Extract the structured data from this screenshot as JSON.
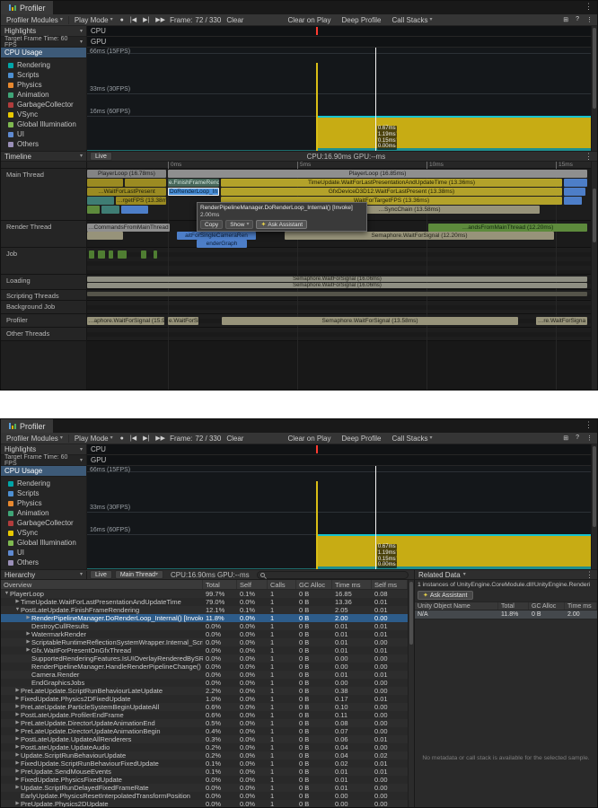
{
  "stats": "CPU:16.90ms   GPU:--ms",
  "icons": {
    "chevron": "▾",
    "kebab": "⋮",
    "record": "●",
    "step_back": "|◀",
    "step_fwd": "▶|",
    "step_last": "▶▶",
    "grid": "⊞",
    "help": "?",
    "sparkle": "✦"
  },
  "tab": {
    "title": "Profiler"
  },
  "toolbar": {
    "modules": "Profiler Modules",
    "play_mode": "Play Mode",
    "frame_label": "Frame:",
    "frame_value": "72 / 330",
    "clear": "Clear",
    "clear_on_play": "Clear on Play",
    "deep_profile": "Deep Profile",
    "call_stacks": "Call Stacks"
  },
  "highlights": {
    "title": "Highlights",
    "target": "Target Frame Time: 60 FPS",
    "cpu_label": "CPU",
    "gpu_label": "GPU"
  },
  "cpu_module": {
    "title": "CPU Usage",
    "legend": [
      {
        "label": "Rendering",
        "color": "#00a5a8",
        "sw": "background:#00a5a8"
      },
      {
        "label": "Scripts",
        "color": "#4d8fd1",
        "sw": "background:#4d8fd1"
      },
      {
        "label": "Physics",
        "color": "#e8882e",
        "sw": "background:#e8882e"
      },
      {
        "label": "Animation",
        "color": "#3fa577",
        "sw": "background:#3fa577"
      },
      {
        "label": "GarbageCollector",
        "color": "#b03c3c",
        "sw": "background:#b03c3c"
      },
      {
        "label": "VSync",
        "color": "#e8c800",
        "sw": "background:#e8c800"
      },
      {
        "label": "Global Illumination",
        "color": "#7fb950",
        "sw": "background:#7fb950"
      },
      {
        "label": "UI",
        "color": "#5f8ad1",
        "sw": "background:#5f8ad1"
      },
      {
        "label": "Others",
        "color": "#9a8fb8",
        "sw": "background:#9a8fb8"
      }
    ],
    "gridlines": [
      {
        "label": "66ms (15FPS)"
      },
      {
        "label": "33ms (30FPS)"
      },
      {
        "label": "16ms (60FPS)"
      }
    ],
    "frame_values": [
      {
        "label": "0.67ms",
        "style": "bottom:21px"
      },
      {
        "label": "1.19ms",
        "style": "bottom:14px"
      },
      {
        "label": "0.15ms",
        "style": "bottom:7px"
      },
      {
        "label": "0.00ms",
        "style": "bottom:1px"
      }
    ]
  },
  "timeline": {
    "title": "Timeline",
    "live": "Live",
    "ruler": [
      {
        "label": "0ms",
        "style": "left:90px"
      },
      {
        "label": "5ms",
        "style": "left:234px"
      },
      {
        "label": "10ms",
        "style": "left:378px"
      },
      {
        "label": "15ms",
        "style": "left:522px"
      }
    ],
    "threads": [
      {
        "label": "Main Thread",
        "style": "height:58px"
      },
      {
        "label": "Render Thread",
        "style": "height:30px"
      },
      {
        "label": "Job",
        "style": "height:30px"
      },
      {
        "label": "Loading",
        "style": "height:17px"
      },
      {
        "label": "Scripting Threads",
        "style": "height:12px"
      },
      {
        "label": "Background Job",
        "style": "height:15px"
      },
      {
        "label": "Profiler",
        "style": "height:15px"
      },
      {
        "label": "Other Threads",
        "style": "height:15px"
      }
    ],
    "bars": [
      {
        "style": "left:0px;top:1px;width:88px;background:#848484;color:#1b1b1b",
        "label": "PlayerLoop (16.78ms)"
      },
      {
        "style": "left:90px;top:1px;width:467px;background:#8f8f8f;color:#1b1b1b",
        "label": "PlayerLoop (16.85ms)"
      },
      {
        "style": "left:0px;top:11px;width:40px;background:#9b8b22;color:#20200a",
        "label": ""
      },
      {
        "style": "left:42px;top:11px;width:46px;background:#9b8b22;color:#20200a",
        "label": ""
      },
      {
        "style": "left:90px;top:11px;width:57px;background:#47675a;color:#d8e8e0",
        "label": "e.FinishFrameRende"
      },
      {
        "style": "left:149px;top:11px;width:380px;background:#b3a22a;color:#1e1c05",
        "label": "TimeUpdate.WaitForLastPresentationAndUpdateTime (13.36ms)"
      },
      {
        "style": "left:531px;top:11px;width:26px;background:#4d7ec8;color:#0b1d36",
        "label": ""
      },
      {
        "style": "left:0px;top:21px;width:88px;background:#9b8b22;color:#20200a",
        "label": "…WaitForLastPresent"
      },
      {
        "style": "left:90px;top:21px;width:57px;background:#4a90d9;color:#081c30;outline:1px solid #f0f0f0;outline-offset:-1px",
        "label": "DoRenderLoop_In"
      },
      {
        "style": "left:149px;top:21px;width:380px;background:#b3a22a;color:#1e1c05",
        "label": "GfxDeviceD3D12.WaitForLastPresent (13.38ms)"
      },
      {
        "style": "left:531px;top:21px;width:24px;background:#4d7ec8;color:#0b1d36",
        "label": ""
      },
      {
        "style": "left:0px;top:31px;width:30px;background:#3f7d74;color:#0c1f1c",
        "label": ""
      },
      {
        "style": "left:32px;top:31px;width:56px;background:#9b8b22;color:#20200a",
        "label": "…rgetFPS (13.38ms)"
      },
      {
        "style": "left:149px;top:31px;width:380px;background:#b3a22a;color:#1e1c05",
        "label": "WaitForTargetFPS (13.36ms)"
      },
      {
        "style": "left:531px;top:31px;width:20px;background:#4d7ec8;color:#0b1d36",
        "label": ""
      },
      {
        "style": "left:0px;top:41px;width:14px;background:#5d8a3c;color:#10270c",
        "label": ""
      },
      {
        "style": "left:16px;top:41px;width:20px;background:#3f7d74;color:#0c1f1c",
        "label": ""
      },
      {
        "style": "left:38px;top:41px;width:30px;background:#4d7ec8;color:#0b1d36",
        "label": ""
      },
      {
        "style": "left:214px;top:41px;width:290px;background:#97937a;color:#23231a",
        "label": "…SyncChain (13.58ms)"
      },
      {
        "style": "left:0px;top:61px;width:92px;background:#8f8f8f;color:#1b1b1b",
        "label": "…CommandsFromMainThread (13.88ms)"
      },
      {
        "style": "left:380px;top:61px;width:177px;background:#5d8a3c;color:#10270c",
        "label": "…andsFromMainThread (12.20ms)"
      },
      {
        "style": "left:0px;top:70px;width:40px;background:#97937a;color:#23231a",
        "label": ""
      },
      {
        "style": "left:100px;top:70px;width:88px;background:#4d7ec8;color:#0b1d36",
        "label": "aitForSingleCameraRen"
      },
      {
        "style": "left:220px;top:70px;width:300px;background:#97937a;color:#23231a",
        "label": "Semaphore.WaitForSignal (12.20ms)"
      },
      {
        "style": "left:122px;top:79px;width:56px;background:#4d7ec8;color:#0b1d36",
        "label": "enderGraph"
      },
      {
        "style": "left:2px;top:91px;width:6px;background:#4f7d32",
        "label": ""
      },
      {
        "style": "left:12px;top:91px;width:8px;background:#4f7d32",
        "label": ""
      },
      {
        "style": "left:24px;top:91px;width:5px;background:#4f7d32",
        "label": ""
      },
      {
        "style": "left:34px;top:91px;width:10px;background:#4f7d32",
        "label": ""
      },
      {
        "style": "left:60px;top:91px;width:6px;background:#4f7d32",
        "label": ""
      },
      {
        "style": "left:74px;top:91px;width:4px;background:#4f7d32",
        "label": ""
      },
      {
        "style": "left:0px;top:120px;width:557px;height:6px;line-height:6px;font-size:6px;background:#8e8e82;color:#23231a",
        "label": "Semaphore.WaitForSignal (16.06ms)"
      },
      {
        "style": "left:0px;top:127px;width:557px;height:6px;line-height:6px;font-size:6px;background:#8e8e82;color:#23231a",
        "label": "Semaphore.WaitForSignal (16.06ms)"
      },
      {
        "style": "left:0px;top:137px;width:557px;height:5px;background:#55544a",
        "label": ""
      },
      {
        "style": "left:0px;top:165px;width:86px;background:#97937a;color:#23231a",
        "label": "…aphore.WaitForSignal (15.92ms)"
      },
      {
        "style": "left:90px;top:165px;width:34px;background:#97937a;color:#23231a",
        "label": "e.WaitForSign"
      },
      {
        "style": "left:150px;top:165px;width:330px;background:#97937a;color:#23231a",
        "label": "Semaphore.WaitForSignal (13.58ms)"
      },
      {
        "style": "left:500px;top:165px;width:57px;background:#97937a;color:#23231a",
        "label": "…re.WaitForSigna"
      }
    ],
    "tooltip": {
      "title": "RenderPipelineManager.DoRenderLoop_Internal() [Invoke]",
      "time": "2.00ms",
      "copy": "Copy",
      "show": "Show",
      "ask": "Ask Assistant"
    }
  },
  "hierarchy": {
    "title": "Hierarchy",
    "live": "Live",
    "thread": "Main Thread",
    "search_value": "",
    "columns": [
      "Overview",
      "Total",
      "Self",
      "Calls",
      "GC Alloc",
      "Time ms",
      "Self ms"
    ],
    "rows": [
      {
        "name": "PlayerLoop",
        "arrow": "▼",
        "ind": "width:3px",
        "sel": "false",
        "total": "99.7%",
        "self": "0.1%",
        "calls": "1",
        "gc": "0 B",
        "time": "16.85",
        "selfms": "0.08"
      },
      {
        "name": "TimeUpdate.WaitForLastPresentationAndUpdateTime",
        "arrow": "▶",
        "ind": "width:15px",
        "sel": "false",
        "total": "79.0%",
        "self": "0.0%",
        "calls": "1",
        "gc": "0 B",
        "time": "13.36",
        "selfms": "0.01"
      },
      {
        "name": "PostLateUpdate.FinishFrameRendering",
        "arrow": "▼",
        "ind": "width:15px",
        "sel": "false",
        "total": "12.1%",
        "self": "0.1%",
        "calls": "1",
        "gc": "0 B",
        "time": "2.05",
        "selfms": "0.01"
      },
      {
        "name": "RenderPipelineManager.DoRenderLoop_Internal() [Invoke]",
        "arrow": "▶",
        "ind": "width:27px",
        "sel": "true",
        "total": "11.8%",
        "self": "0.0%",
        "calls": "1",
        "gc": "0 B",
        "time": "2.00",
        "selfms": "0.00"
      },
      {
        "name": "DestroyCullResults",
        "arrow": "",
        "ind": "width:27px",
        "sel": "false",
        "total": "0.0%",
        "self": "0.0%",
        "calls": "1",
        "gc": "0 B",
        "time": "0.01",
        "selfms": "0.01"
      },
      {
        "name": "WatermarkRender",
        "arrow": "▶",
        "ind": "width:27px",
        "sel": "false",
        "total": "0.0%",
        "self": "0.0%",
        "calls": "1",
        "gc": "0 B",
        "time": "0.01",
        "selfms": "0.01"
      },
      {
        "name": "ScriptableRuntimeReflectionSystemWrapper.Internal_Scrip",
        "arrow": "▶",
        "ind": "width:27px",
        "sel": "false",
        "total": "0.0%",
        "self": "0.0%",
        "calls": "1",
        "gc": "0 B",
        "time": "0.01",
        "selfms": "0.00"
      },
      {
        "name": "Gfx.WaitForPresentOnGfxThread",
        "arrow": "▶",
        "ind": "width:27px",
        "sel": "false",
        "total": "0.0%",
        "self": "0.0%",
        "calls": "1",
        "gc": "0 B",
        "time": "0.01",
        "selfms": "0.01"
      },
      {
        "name": "SupportedRenderingFeatures.IsUIOverlayRenderedBySRP()",
        "arrow": "",
        "ind": "width:27px",
        "sel": "false",
        "total": "0.0%",
        "self": "0.0%",
        "calls": "1",
        "gc": "0 B",
        "time": "0.00",
        "selfms": "0.00"
      },
      {
        "name": "RenderPipelineManager.HandleRenderPipelineChange() [Inv",
        "arrow": "",
        "ind": "width:27px",
        "sel": "false",
        "total": "0.0%",
        "self": "0.0%",
        "calls": "1",
        "gc": "0 B",
        "time": "0.00",
        "selfms": "0.00"
      },
      {
        "name": "Camera.Render",
        "arrow": "",
        "ind": "width:27px",
        "sel": "false",
        "total": "0.0%",
        "self": "0.0%",
        "calls": "1",
        "gc": "0 B",
        "time": "0.01",
        "selfms": "0.01"
      },
      {
        "name": "EndGraphicsJobs",
        "arrow": "",
        "ind": "width:27px",
        "sel": "false",
        "total": "0.0%",
        "self": "0.0%",
        "calls": "1",
        "gc": "0 B",
        "time": "0.00",
        "selfms": "0.00"
      },
      {
        "name": "PreLateUpdate.ScriptRunBehaviourLateUpdate",
        "arrow": "▶",
        "ind": "width:15px",
        "sel": "false",
        "total": "2.2%",
        "self": "0.0%",
        "calls": "1",
        "gc": "0 B",
        "time": "0.38",
        "selfms": "0.00"
      },
      {
        "name": "FixedUpdate.Physics2DFixedUpdate",
        "arrow": "▶",
        "ind": "width:15px",
        "sel": "false",
        "total": "1.0%",
        "self": "0.0%",
        "calls": "1",
        "gc": "0 B",
        "time": "0.17",
        "selfms": "0.01"
      },
      {
        "name": "PreLateUpdate.ParticleSystemBeginUpdateAll",
        "arrow": "▶",
        "ind": "width:15px",
        "sel": "false",
        "total": "0.6%",
        "self": "0.0%",
        "calls": "1",
        "gc": "0 B",
        "time": "0.10",
        "selfms": "0.00"
      },
      {
        "name": "PostLateUpdate.ProfilerEndFrame",
        "arrow": "▶",
        "ind": "width:15px",
        "sel": "false",
        "total": "0.6%",
        "self": "0.0%",
        "calls": "1",
        "gc": "0 B",
        "time": "0.11",
        "selfms": "0.00"
      },
      {
        "name": "PreLateUpdate.DirectorUpdateAnimationEnd",
        "arrow": "▶",
        "ind": "width:15px",
        "sel": "false",
        "total": "0.5%",
        "self": "0.0%",
        "calls": "1",
        "gc": "0 B",
        "time": "0.08",
        "selfms": "0.00"
      },
      {
        "name": "PreLateUpdate.DirectorUpdateAnimationBegin",
        "arrow": "▶",
        "ind": "width:15px",
        "sel": "false",
        "total": "0.4%",
        "self": "0.0%",
        "calls": "1",
        "gc": "0 B",
        "time": "0.07",
        "selfms": "0.00"
      },
      {
        "name": "PostLateUpdate.UpdateAllRenderers",
        "arrow": "▶",
        "ind": "width:15px",
        "sel": "false",
        "total": "0.3%",
        "self": "0.0%",
        "calls": "1",
        "gc": "0 B",
        "time": "0.06",
        "selfms": "0.01"
      },
      {
        "name": "PostLateUpdate.UpdateAudio",
        "arrow": "▶",
        "ind": "width:15px",
        "sel": "false",
        "total": "0.2%",
        "self": "0.0%",
        "calls": "1",
        "gc": "0 B",
        "time": "0.04",
        "selfms": "0.00"
      },
      {
        "name": "Update.ScriptRunBehaviourUpdate",
        "arrow": "▶",
        "ind": "width:15px",
        "sel": "false",
        "total": "0.2%",
        "self": "0.0%",
        "calls": "1",
        "gc": "0 B",
        "time": "0.04",
        "selfms": "0.02"
      },
      {
        "name": "FixedUpdate.ScriptRunBehaviourFixedUpdate",
        "arrow": "▶",
        "ind": "width:15px",
        "sel": "false",
        "total": "0.1%",
        "self": "0.0%",
        "calls": "1",
        "gc": "0 B",
        "time": "0.02",
        "selfms": "0.01"
      },
      {
        "name": "PreUpdate.SendMouseEvents",
        "arrow": "▶",
        "ind": "width:15px",
        "sel": "false",
        "total": "0.1%",
        "self": "0.0%",
        "calls": "1",
        "gc": "0 B",
        "time": "0.01",
        "selfms": "0.01"
      },
      {
        "name": "FixedUpdate.PhysicsFixedUpdate",
        "arrow": "▶",
        "ind": "width:15px",
        "sel": "false",
        "total": "0.0%",
        "self": "0.0%",
        "calls": "1",
        "gc": "0 B",
        "time": "0.01",
        "selfms": "0.00"
      },
      {
        "name": "Update.ScriptRunDelayedFixedFrameRate",
        "arrow": "▶",
        "ind": "width:15px",
        "sel": "false",
        "total": "0.0%",
        "self": "0.0%",
        "calls": "1",
        "gc": "0 B",
        "time": "0.01",
        "selfms": "0.00"
      },
      {
        "name": "EarlyUpdate.PhysicsResetInterpolatedTransformPosition",
        "arrow": "",
        "ind": "width:15px",
        "sel": "false",
        "total": "0.0%",
        "self": "0.0%",
        "calls": "1",
        "gc": "0 B",
        "time": "0.00",
        "selfms": "0.00"
      },
      {
        "name": "PreUpdate.Physics2DUpdate",
        "arrow": "▶",
        "ind": "width:15px",
        "sel": "false",
        "total": "0.0%",
        "self": "0.0%",
        "calls": "1",
        "gc": "0 B",
        "time": "0.00",
        "selfms": "0.00"
      }
    ]
  },
  "related": {
    "title": "Related Data",
    "info": "1 instances of UnityEngine.CoreModule.dll!UnityEngine.Renderi",
    "ask": "Ask Assistant",
    "columns": [
      "Unity Object Name",
      "Total",
      "GC Alloc",
      "Time ms"
    ],
    "rows": [
      {
        "name": "N/A",
        "total": "11.8%",
        "gc": "0 B",
        "time": "2.00"
      }
    ],
    "empty_message": "No metadata or call stack is available for the selected sample."
  }
}
